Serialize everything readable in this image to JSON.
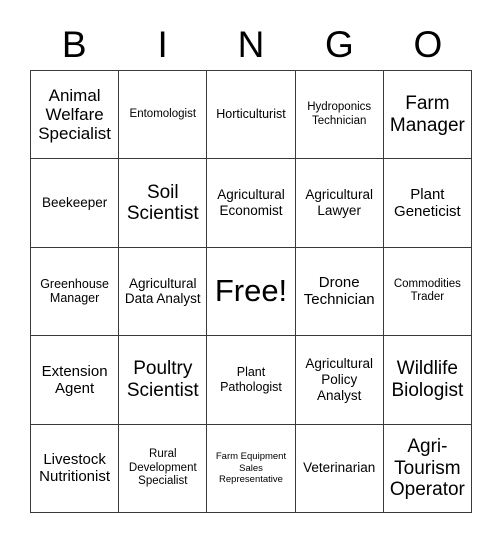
{
  "card": {
    "title": "BINGO",
    "header_letters": [
      "B",
      "I",
      "N",
      "G",
      "O"
    ],
    "free_space_label": "Free!",
    "colors": {
      "background": "#ffffff",
      "text": "#000000",
      "grid_line": "#3a3a3a"
    },
    "grid": {
      "columns": 5,
      "rows": 5,
      "cells": [
        {
          "text": "Animal Welfare Specialist",
          "size": "fs-17",
          "free": false
        },
        {
          "text": "Entomologist",
          "size": "fs-11",
          "free": false
        },
        {
          "text": "Horticulturist",
          "size": "fs-12",
          "free": false
        },
        {
          "text": "Hydroponics Technician",
          "size": "fs-11",
          "free": false
        },
        {
          "text": "Farm Manager",
          "size": "fs-19",
          "free": false
        },
        {
          "text": "Beekeeper",
          "size": "fs-13",
          "free": false
        },
        {
          "text": "Soil Scientist",
          "size": "fs-19",
          "free": false
        },
        {
          "text": "Agricultural Economist",
          "size": "fs-13",
          "free": false
        },
        {
          "text": "Agricultural Lawyer",
          "size": "fs-13",
          "free": false
        },
        {
          "text": "Plant Geneticist",
          "size": "fs-15",
          "free": false
        },
        {
          "text": "Greenhouse Manager",
          "size": "fs-12",
          "free": false
        },
        {
          "text": "Agricultural Data Analyst",
          "size": "fs-13",
          "free": false
        },
        {
          "text": "Free!",
          "size": "fs-free",
          "free": true
        },
        {
          "text": "Drone Technician",
          "size": "fs-15",
          "free": false
        },
        {
          "text": "Commodities Trader",
          "size": "fs-11",
          "free": false
        },
        {
          "text": "Extension Agent",
          "size": "fs-15",
          "free": false
        },
        {
          "text": "Poultry Scientist",
          "size": "fs-19",
          "free": false
        },
        {
          "text": "Plant Pathologist",
          "size": "fs-12",
          "free": false
        },
        {
          "text": "Agricultural Policy Analyst",
          "size": "fs-13",
          "free": false
        },
        {
          "text": "Wildlife Biologist",
          "size": "fs-19",
          "free": false
        },
        {
          "text": "Livestock Nutritionist",
          "size": "fs-15",
          "free": false
        },
        {
          "text": "Rural Development Specialist",
          "size": "fs-11",
          "free": false
        },
        {
          "text": "Farm Equipment Sales Representative",
          "size": "fs-9",
          "free": false
        },
        {
          "text": "Veterinarian",
          "size": "fs-13",
          "free": false
        },
        {
          "text": "Agri- Tourism Operator",
          "size": "fs-19",
          "free": false
        }
      ]
    }
  }
}
